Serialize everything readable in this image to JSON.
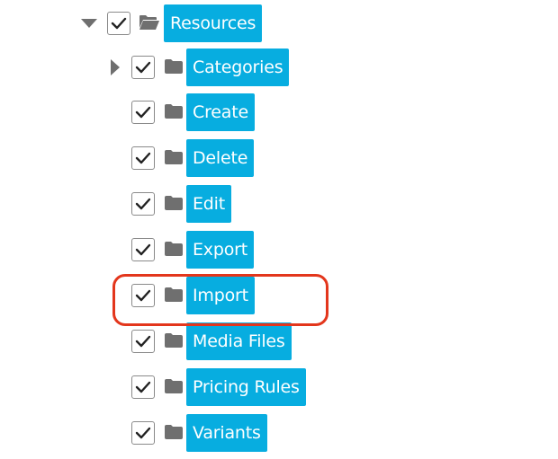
{
  "tree": {
    "root": {
      "label": "Resources",
      "expanded": true,
      "checked": true
    },
    "children": [
      {
        "label": "Categories",
        "checked": true,
        "has_children": true,
        "expanded": false
      },
      {
        "label": "Create",
        "checked": true
      },
      {
        "label": "Delete",
        "checked": true
      },
      {
        "label": "Edit",
        "checked": true
      },
      {
        "label": "Export",
        "checked": true
      },
      {
        "label": "Import",
        "checked": true,
        "highlighted": true
      },
      {
        "label": "Media Files",
        "checked": true
      },
      {
        "label": "Pricing Rules",
        "checked": true
      },
      {
        "label": "Variants",
        "checked": true
      }
    ]
  },
  "icons": {
    "expanded_toggle": "caret-down-icon",
    "collapsed_toggle": "caret-right-icon",
    "checkbox": "checkmark-icon",
    "root_folder": "folder-open-icon",
    "child_folder": "folder-icon"
  },
  "colors": {
    "label_background": "#07ade0",
    "label_text": "#ffffff",
    "icon_gray": "#6f6f6f",
    "checkmark": "#222222",
    "highlight_border": "#e3361c"
  }
}
